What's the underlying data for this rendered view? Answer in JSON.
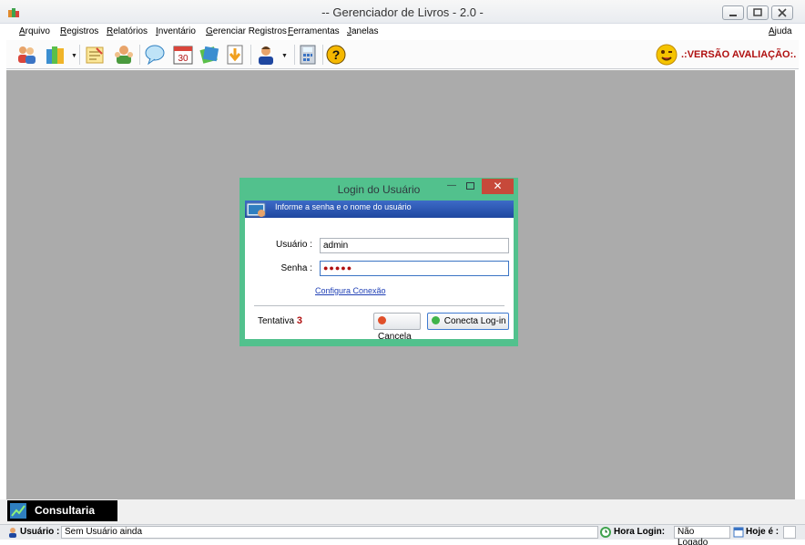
{
  "window": {
    "title": "-- Gerenciador de Livros - 2.0 -"
  },
  "menu": {
    "items": [
      "Arquivo",
      "Registros",
      "Relatórios",
      "Inventário",
      "Gerenciar Registros",
      "Ferramentas",
      "Janelas"
    ],
    "help": "Ajuda"
  },
  "toolbar": {
    "icons": [
      "users-icon",
      "books-icon",
      "register-icon",
      "people-icon",
      "chat-icon",
      "calendar-icon",
      "notebook-icon",
      "download-icon",
      "user-icon",
      "calculator-icon",
      "help-icon"
    ],
    "evaluation_text": ".:VERSÃO AVALIAÇÃO:."
  },
  "login_dialog": {
    "title": "Login do Usuário",
    "header_text": "Informe a senha e o nome do usuário",
    "user_label": "Usuário :",
    "user_value": "admin",
    "password_label": "Senha :",
    "password_mask": "●●●●●",
    "config_link": "Configura Conexão",
    "attempt_label": "Tentativa",
    "attempt_count": "3",
    "cancel_label": "Cancela",
    "connect_label": "Conecta Log-in"
  },
  "consult_panel": {
    "label": "Consultaria"
  },
  "status": {
    "user_label": "Usuário :",
    "user_value": "Sem Usuário ainda",
    "login_time_label": "Hora Login:",
    "login_time_value": "Não Logado",
    "today_label": "Hoje é :"
  },
  "colors": {
    "dialog_frame": "#52c18d",
    "dialog_header": "#1f47a0",
    "close_button": "#c7493a",
    "mdi_background": "#ababab",
    "evaluation_text": "#b01010"
  }
}
